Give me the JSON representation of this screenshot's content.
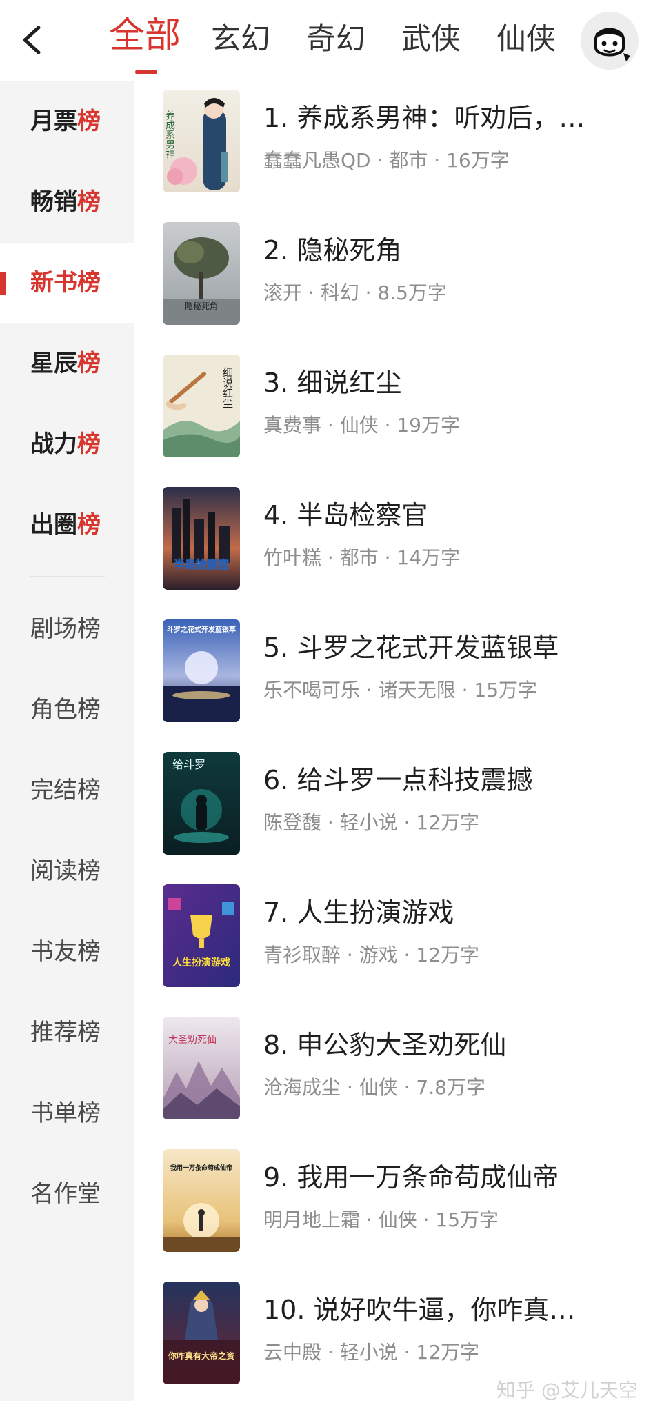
{
  "header": {
    "tabs": [
      {
        "label": "全部",
        "active": true
      },
      {
        "label": "玄幻",
        "active": false
      },
      {
        "label": "奇幻",
        "active": false
      },
      {
        "label": "武侠",
        "active": false
      },
      {
        "label": "仙侠",
        "active": false
      }
    ],
    "back_icon": "chevron-left-icon",
    "avatar_icon": "user-avatar-icon"
  },
  "sidebar": {
    "major": [
      {
        "prefix": "月票",
        "accent": "榜",
        "active": false
      },
      {
        "prefix": "畅销",
        "accent": "榜",
        "active": false
      },
      {
        "prefix": "新书",
        "accent": "榜",
        "active": true
      },
      {
        "prefix": "星辰",
        "accent": "榜",
        "active": false
      },
      {
        "prefix": "战力",
        "accent": "榜",
        "active": false
      },
      {
        "prefix": "出圈",
        "accent": "榜",
        "active": false
      }
    ],
    "minor": [
      {
        "label": "剧场榜"
      },
      {
        "label": "角色榜"
      },
      {
        "label": "完结榜"
      },
      {
        "label": "阅读榜"
      },
      {
        "label": "书友榜"
      },
      {
        "label": "推荐榜"
      },
      {
        "label": "书单榜"
      },
      {
        "label": "名作堂"
      }
    ]
  },
  "books": [
    {
      "title": "1. 养成系男神：听劝后，…",
      "meta": "蠢蠢凡愚QD · 都市 · 16万字"
    },
    {
      "title": "2. 隐秘死角",
      "meta": "滚开 · 科幻 · 8.5万字"
    },
    {
      "title": "3. 细说红尘",
      "meta": "真费事 · 仙侠 · 19万字"
    },
    {
      "title": "4. 半岛检察官",
      "meta": "竹叶糕 · 都市 · 14万字"
    },
    {
      "title": "5. 斗罗之花式开发蓝银草",
      "meta": "乐不喝可乐 · 诸天无限 · 15万字"
    },
    {
      "title": "6. 给斗罗一点科技震撼",
      "meta": "陈登馥 · 轻小说 · 12万字"
    },
    {
      "title": "7. 人生扮演游戏",
      "meta": "青衫取醉 · 游戏 · 12万字"
    },
    {
      "title": "8. 申公豹大圣劝死仙",
      "meta": "沧海成尘 · 仙侠 · 7.8万字"
    },
    {
      "title": "9. 我用一万条命苟成仙帝",
      "meta": "明月地上霜 · 仙侠 · 15万字"
    },
    {
      "title": "10. 说好吹牛逼，你咋真…",
      "meta": "云中殿 · 轻小说 · 12万字"
    }
  ],
  "covers": {
    "c1": {
      "text": "养成系男神"
    },
    "c2": {
      "text": "隐秘死角"
    },
    "c3": {
      "text": "细说红尘"
    },
    "c4": {
      "text": "半岛检察官"
    },
    "c5": {
      "text": "斗罗之花式开发蓝银草"
    },
    "c6": {
      "text": "给斗罗"
    },
    "c7": {
      "text": "人生扮演游戏"
    },
    "c8": {
      "text": "大圣劝死仙"
    },
    "c9": {
      "text": "我用一万条命苟成仙帝"
    },
    "c10": {
      "text": "你咋真有大帝之资"
    }
  },
  "watermark": "知乎 @艾儿天空",
  "colors": {
    "accent": "#d8352f",
    "sidebar_bg": "#f4f4f4",
    "meta_text": "#8e8e8e"
  }
}
